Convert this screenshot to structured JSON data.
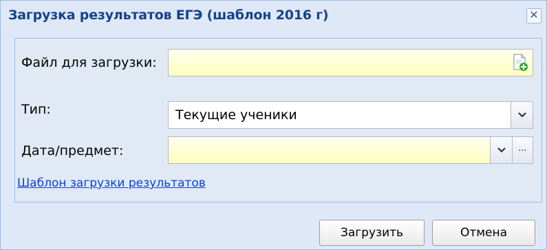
{
  "window": {
    "title": "Загрузка результатов ЕГЭ (шаблон 2016 г)",
    "close_glyph": "✕"
  },
  "form": {
    "file_label": "Файл для загрузки:",
    "file_value": "",
    "type_label": "Тип:",
    "type_value": "Текущие ученики",
    "date_subject_label": "Дата/предмет:",
    "date_subject_value": "",
    "more_glyph": "···"
  },
  "template_link": "Шаблон загрузки результатов",
  "buttons": {
    "upload": "Загрузить",
    "cancel": "Отмена"
  },
  "colors": {
    "required_field_bg": "#ffffcc",
    "title_color": "#15428b",
    "link_color": "#0b3fd6",
    "border": "#99bbe8"
  }
}
